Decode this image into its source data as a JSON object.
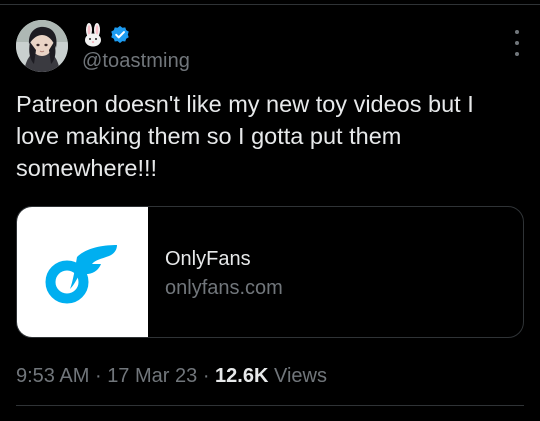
{
  "author": {
    "handle": "@toastming",
    "display_name_icon": "bunny-emoji-icon",
    "verified_icon": "verified-badge-icon",
    "verified_color": "#1d9bf0"
  },
  "tweet": {
    "text": "Patreon doesn't like my new toy videos but I love making them so I gotta put them somewhere!!!"
  },
  "link_card": {
    "title": "OnlyFans",
    "domain": "onlyfans.com",
    "logo_icon": "onlyfans-logo-icon",
    "logo_color": "#00aff0"
  },
  "meta": {
    "time": "9:53 AM",
    "separator": "·",
    "date": "17 Mar 23",
    "views_count": "12.6K",
    "views_label": "Views"
  },
  "more_icon": "more-dots-icon"
}
